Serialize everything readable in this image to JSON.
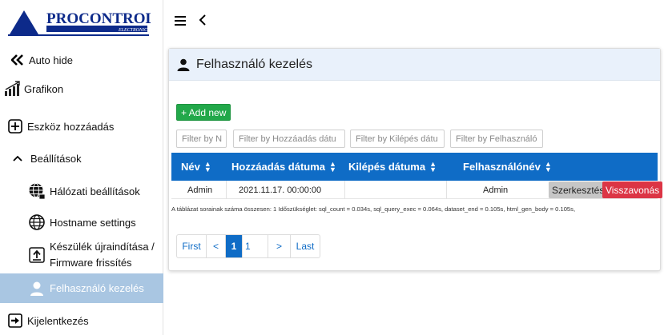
{
  "brand": {
    "name": "PROCONTROL",
    "tagline": "ELECTRONICS",
    "color": "#0d2a8a"
  },
  "sidebar": {
    "items": [
      {
        "label": "Auto hide",
        "icon": "double-chevron-left-icon"
      },
      {
        "label": "Grafikon",
        "icon": "bar-chart-icon"
      },
      {
        "label": "Eszköz hozzáadás",
        "icon": "plus-box-icon"
      },
      {
        "label": "Beállítások",
        "icon": "chevron-up-icon"
      },
      {
        "label": "Hálózati beállítások",
        "icon": "network-globe-icon"
      },
      {
        "label": "Hostname settings",
        "icon": "globe-icon"
      },
      {
        "label": "Készülék újraindítása /",
        "label2": "Firmware frissítés",
        "icon": "upload-icon"
      },
      {
        "label": "Felhasználó kezelés",
        "icon": "user-icon",
        "active": true
      },
      {
        "label": "Kijelentkezés",
        "icon": "logout-icon"
      }
    ]
  },
  "topbar": {
    "menu_icon": "hamburger-icon",
    "back_icon": "chevron-left-icon"
  },
  "page": {
    "title": "Felhasználó kezelés",
    "add_label": "+ Add new"
  },
  "filters": {
    "name": "Filter by N",
    "added": "Filter by Hozzáadás dátu",
    "exit": "Filter by Kilépés dátu",
    "user": "Filter by Felhasználó"
  },
  "table": {
    "columns": [
      "Név",
      "Hozzáadás dátuma",
      "Kilépés dátuma",
      "Felhasználónév"
    ],
    "rows": [
      {
        "name": "Admin",
        "added": "2021.11.17. 00:00:00",
        "exit": "",
        "username": "Admin",
        "edit_label": "Szerkesztés",
        "revoke_label": "Visszavonás"
      }
    ]
  },
  "summary": "A táblázat sorainak száma összesen: 1   Időszükséglet: sql_count = 0.034s, sql_query_exec = 0.064s, dataset_end = 0.105s, html_gen_body = 0.105s,",
  "pager": {
    "first": "First",
    "prev": "<",
    "current": "1",
    "total": "1",
    "next": ">",
    "last": "Last"
  },
  "colors": {
    "accent": "#0f6cc6",
    "add": "#22a84a",
    "danger": "#dc3545",
    "active_nav": "#a9c6e2"
  }
}
